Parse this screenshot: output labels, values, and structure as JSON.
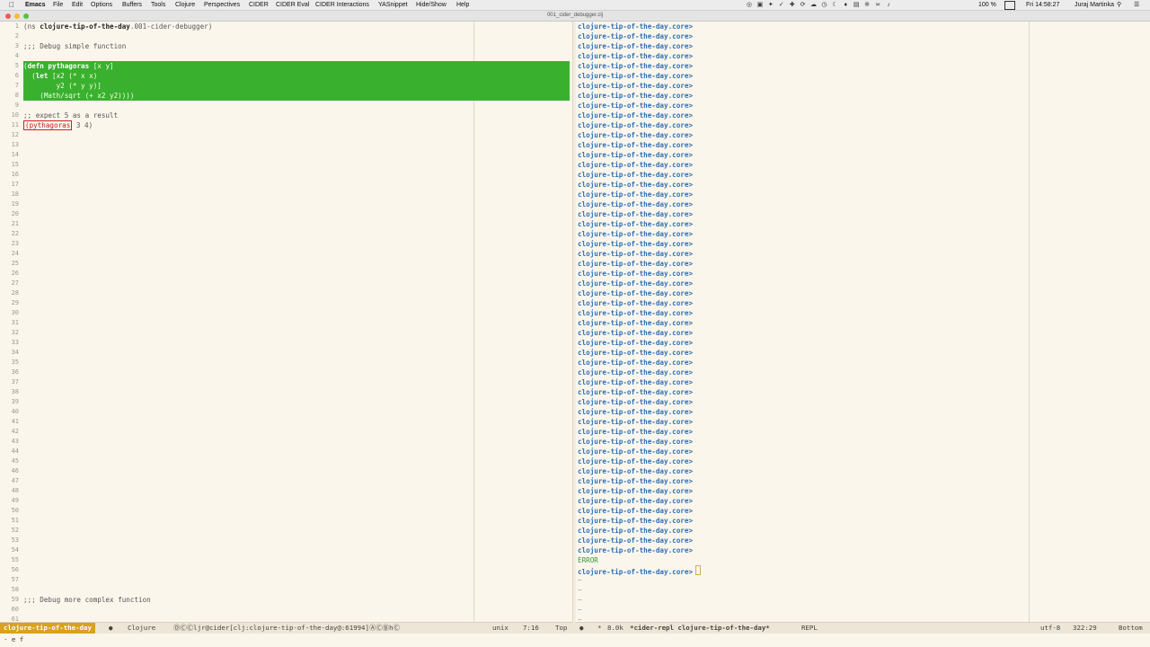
{
  "menubar": {
    "app": "Emacs",
    "items": [
      "File",
      "Edit",
      "Options",
      "Buffers",
      "Tools",
      "Clojure",
      "Perspectives",
      "CIDER",
      "CIDER Eval",
      "CIDER Interactions",
      "YASnippet",
      "Hide/Show",
      "Help"
    ],
    "battery": "100 %",
    "clock": "Fri 14:58:27",
    "user": "Juraj Martinka"
  },
  "window": {
    "title": "001_cider_debugger.clj"
  },
  "editor": {
    "line_numbers": [
      "1",
      "2",
      "3",
      "4",
      "5",
      "6",
      "7",
      "8",
      "9",
      "10",
      "11",
      "12",
      "13",
      "14",
      "15",
      "16",
      "17",
      "18",
      "19",
      "20",
      "21",
      "22",
      "23",
      "24",
      "25",
      "26",
      "27",
      "28",
      "29",
      "30",
      "31",
      "32",
      "33",
      "34",
      "35",
      "36",
      "37",
      "38",
      "39",
      "40",
      "41",
      "42",
      "43",
      "44",
      "45",
      "46",
      "47",
      "48",
      "49",
      "50",
      "51",
      "52",
      "53",
      "54",
      "55",
      "56",
      "57",
      "58",
      "59",
      "60",
      "61"
    ],
    "ns_open": "(ns ",
    "ns_name": "clojure-tip-of-the-day",
    "ns_rest": ".001-cider-debugger)",
    "comment1": ";;; Debug simple function",
    "defn_open": "(",
    "defn_kw": "defn pythagoras",
    "defn_rest": " [x y]",
    "let_open": "  (",
    "let_kw": "let",
    "let_rest": " [x2 (* x x)",
    "let_y2": "        y2 (* y y)]",
    "math_line": "    (Math/sqrt (+ x2 y2))))",
    "comment2": ";; expect 5 as a result",
    "call_open": "(",
    "call_fn": "pythagoras",
    "call_rest": " 3 4)",
    "comment3": ";;; Debug more complex function"
  },
  "repl": {
    "prompt": "clojure-tip-of-the-day.core>",
    "prompt_count": 54,
    "error_text": "ERROR",
    "tilde": "~",
    "tilde_count": 6
  },
  "modeline_left": {
    "buffer": "clojure-tip-of-the-day",
    "mode": "Clojure",
    "cider_info": "ⒹⒸⒸljr@cider[clj:clojure-tip-of-the-day@:61994]ⒶⒸⒷhⒸ",
    "encoding": "unix",
    "position": "7:16",
    "scroll": "Top"
  },
  "modeline_right": {
    "size": "8.0k",
    "buffer": "*cider-repl clojure-tip-of-the-day*",
    "mode": "REPL",
    "encoding": "utf-8",
    "position": "322:29",
    "scroll": "Bottom"
  },
  "minibuffer": {
    "text": "- e f"
  },
  "colors": {
    "background": "#fbf6ec",
    "debug_highlight": "#3ab02f",
    "prompt": "#2d6fb5",
    "modeline_buffer": "#d9a11e",
    "comment": "#2a9a9a",
    "error": "#2d9a3a"
  }
}
